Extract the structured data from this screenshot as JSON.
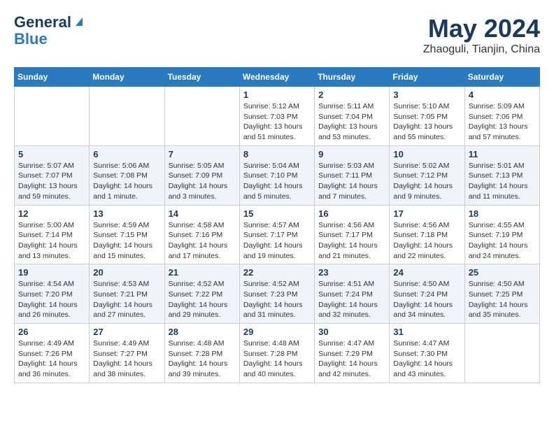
{
  "header": {
    "logo_line1": "General",
    "logo_line2": "Blue",
    "month": "May 2024",
    "location": "Zhaoguli, Tianjin, China"
  },
  "days_of_week": [
    "Sunday",
    "Monday",
    "Tuesday",
    "Wednesday",
    "Thursday",
    "Friday",
    "Saturday"
  ],
  "weeks": [
    {
      "cells": [
        {
          "day": "",
          "info": ""
        },
        {
          "day": "",
          "info": ""
        },
        {
          "day": "",
          "info": ""
        },
        {
          "day": "1",
          "info": "Sunrise: 5:12 AM\nSunset: 7:03 PM\nDaylight: 13 hours\nand 51 minutes."
        },
        {
          "day": "2",
          "info": "Sunrise: 5:11 AM\nSunset: 7:04 PM\nDaylight: 13 hours\nand 53 minutes."
        },
        {
          "day": "3",
          "info": "Sunrise: 5:10 AM\nSunset: 7:05 PM\nDaylight: 13 hours\nand 55 minutes."
        },
        {
          "day": "4",
          "info": "Sunrise: 5:09 AM\nSunset: 7:06 PM\nDaylight: 13 hours\nand 57 minutes."
        }
      ]
    },
    {
      "cells": [
        {
          "day": "5",
          "info": "Sunrise: 5:07 AM\nSunset: 7:07 PM\nDaylight: 13 hours\nand 59 minutes."
        },
        {
          "day": "6",
          "info": "Sunrise: 5:06 AM\nSunset: 7:08 PM\nDaylight: 14 hours\nand 1 minute."
        },
        {
          "day": "7",
          "info": "Sunrise: 5:05 AM\nSunset: 7:09 PM\nDaylight: 14 hours\nand 3 minutes."
        },
        {
          "day": "8",
          "info": "Sunrise: 5:04 AM\nSunset: 7:10 PM\nDaylight: 14 hours\nand 5 minutes."
        },
        {
          "day": "9",
          "info": "Sunrise: 5:03 AM\nSunset: 7:11 PM\nDaylight: 14 hours\nand 7 minutes."
        },
        {
          "day": "10",
          "info": "Sunrise: 5:02 AM\nSunset: 7:12 PM\nDaylight: 14 hours\nand 9 minutes."
        },
        {
          "day": "11",
          "info": "Sunrise: 5:01 AM\nSunset: 7:13 PM\nDaylight: 14 hours\nand 11 minutes."
        }
      ]
    },
    {
      "cells": [
        {
          "day": "12",
          "info": "Sunrise: 5:00 AM\nSunset: 7:14 PM\nDaylight: 14 hours\nand 13 minutes."
        },
        {
          "day": "13",
          "info": "Sunrise: 4:59 AM\nSunset: 7:15 PM\nDaylight: 14 hours\nand 15 minutes."
        },
        {
          "day": "14",
          "info": "Sunrise: 4:58 AM\nSunset: 7:16 PM\nDaylight: 14 hours\nand 17 minutes."
        },
        {
          "day": "15",
          "info": "Sunrise: 4:57 AM\nSunset: 7:17 PM\nDaylight: 14 hours\nand 19 minutes."
        },
        {
          "day": "16",
          "info": "Sunrise: 4:56 AM\nSunset: 7:17 PM\nDaylight: 14 hours\nand 21 minutes."
        },
        {
          "day": "17",
          "info": "Sunrise: 4:56 AM\nSunset: 7:18 PM\nDaylight: 14 hours\nand 22 minutes."
        },
        {
          "day": "18",
          "info": "Sunrise: 4:55 AM\nSunset: 7:19 PM\nDaylight: 14 hours\nand 24 minutes."
        }
      ]
    },
    {
      "cells": [
        {
          "day": "19",
          "info": "Sunrise: 4:54 AM\nSunset: 7:20 PM\nDaylight: 14 hours\nand 26 minutes."
        },
        {
          "day": "20",
          "info": "Sunrise: 4:53 AM\nSunset: 7:21 PM\nDaylight: 14 hours\nand 27 minutes."
        },
        {
          "day": "21",
          "info": "Sunrise: 4:52 AM\nSunset: 7:22 PM\nDaylight: 14 hours\nand 29 minutes."
        },
        {
          "day": "22",
          "info": "Sunrise: 4:52 AM\nSunset: 7:23 PM\nDaylight: 14 hours\nand 31 minutes."
        },
        {
          "day": "23",
          "info": "Sunrise: 4:51 AM\nSunset: 7:24 PM\nDaylight: 14 hours\nand 32 minutes."
        },
        {
          "day": "24",
          "info": "Sunrise: 4:50 AM\nSunset: 7:24 PM\nDaylight: 14 hours\nand 34 minutes."
        },
        {
          "day": "25",
          "info": "Sunrise: 4:50 AM\nSunset: 7:25 PM\nDaylight: 14 hours\nand 35 minutes."
        }
      ]
    },
    {
      "cells": [
        {
          "day": "26",
          "info": "Sunrise: 4:49 AM\nSunset: 7:26 PM\nDaylight: 14 hours\nand 36 minutes."
        },
        {
          "day": "27",
          "info": "Sunrise: 4:49 AM\nSunset: 7:27 PM\nDaylight: 14 hours\nand 38 minutes."
        },
        {
          "day": "28",
          "info": "Sunrise: 4:48 AM\nSunset: 7:28 PM\nDaylight: 14 hours\nand 39 minutes."
        },
        {
          "day": "29",
          "info": "Sunrise: 4:48 AM\nSunset: 7:28 PM\nDaylight: 14 hours\nand 40 minutes."
        },
        {
          "day": "30",
          "info": "Sunrise: 4:47 AM\nSunset: 7:29 PM\nDaylight: 14 hours\nand 42 minutes."
        },
        {
          "day": "31",
          "info": "Sunrise: 4:47 AM\nSunset: 7:30 PM\nDaylight: 14 hours\nand 43 minutes."
        },
        {
          "day": "",
          "info": ""
        }
      ]
    }
  ]
}
